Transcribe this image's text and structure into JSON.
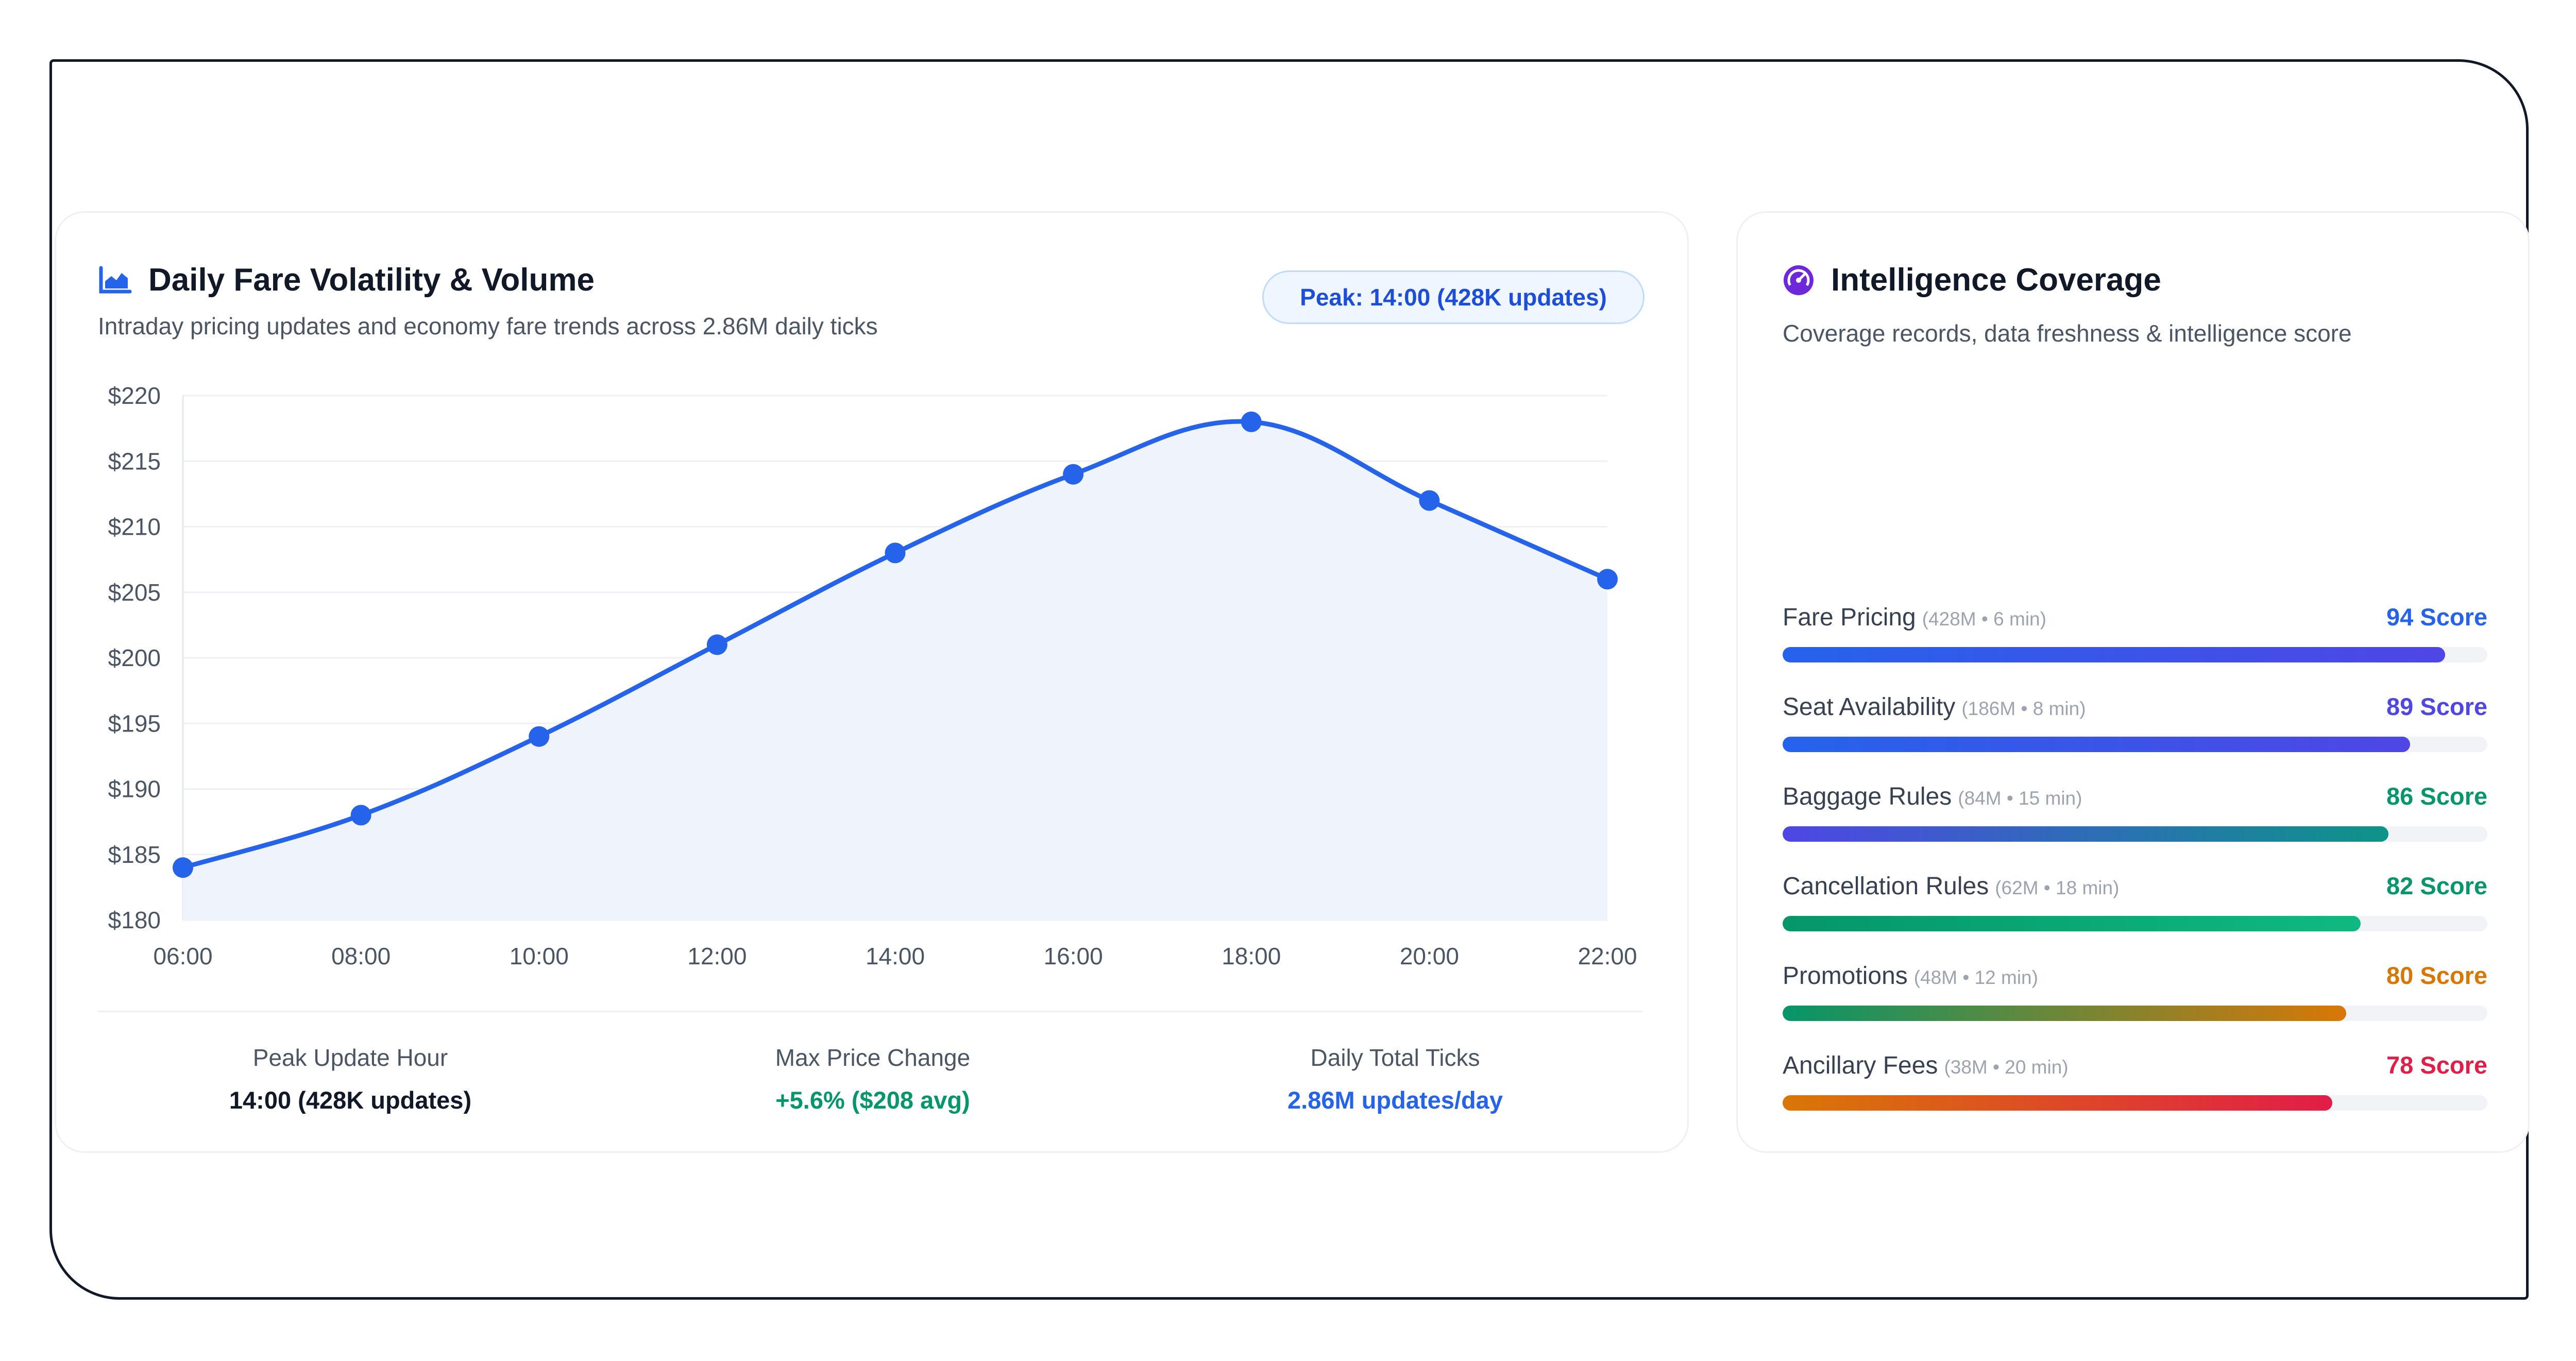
{
  "fare_card": {
    "icon": "area-chart-icon",
    "title": "Daily Fare Volatility & Volume",
    "subtitle": "Intraday pricing updates and economy fare trends across 2.86M daily ticks",
    "peak_badge": "Peak: 14:00 (428K updates)"
  },
  "chart_data": {
    "type": "area",
    "title": "Daily Fare Volatility & Volume",
    "x": [
      "06:00",
      "08:00",
      "10:00",
      "12:00",
      "14:00",
      "16:00",
      "18:00",
      "20:00",
      "22:00"
    ],
    "series": [
      {
        "values": [
          184,
          188,
          194,
          201,
          208,
          214,
          218,
          212,
          206
        ]
      }
    ],
    "y_ticks": [
      "$180",
      "$185",
      "$190",
      "$195",
      "$200",
      "$205",
      "$210",
      "$215",
      "$220"
    ],
    "ylim": [
      180,
      220
    ],
    "xlabel": "",
    "ylabel": "",
    "grid": true,
    "line_color": "#2563eb",
    "fill_color": "#eef3fc"
  },
  "stats": [
    {
      "label": "Peak Update Hour",
      "value": "14:00 (428K updates)",
      "color": "#111827"
    },
    {
      "label": "Max Price Change",
      "value": "+5.6% ($208 avg)",
      "color": "#059669"
    },
    {
      "label": "Daily Total Ticks",
      "value": "2.86M updates/day",
      "color": "#2563eb"
    }
  ],
  "coverage_card": {
    "icon": "gauge-icon",
    "title": "Intelligence Coverage",
    "subtitle": "Coverage records, data freshness & intelligence score",
    "items": [
      {
        "label": "Fare Pricing",
        "meta": "(428M • 6 min)",
        "score": "94 Score",
        "fill": 0.94,
        "score_color": "#2563eb",
        "gradient": [
          "#2563eb",
          "#4f46e5"
        ]
      },
      {
        "label": "Seat Availability",
        "meta": "(186M • 8 min)",
        "score": "89 Score",
        "fill": 0.89,
        "score_color": "#4f46e5",
        "gradient": [
          "#2563eb",
          "#4f46e5"
        ]
      },
      {
        "label": "Baggage Rules",
        "meta": "(84M • 15 min)",
        "score": "86 Score",
        "fill": 0.86,
        "score_color": "#059669",
        "gradient": [
          "#4f46e5",
          "#0d9488"
        ]
      },
      {
        "label": "Cancellation Rules",
        "meta": "(62M • 18 min)",
        "score": "82 Score",
        "fill": 0.82,
        "score_color": "#059669",
        "gradient": [
          "#059669",
          "#10b981"
        ]
      },
      {
        "label": "Promotions",
        "meta": "(48M • 12 min)",
        "score": "80 Score",
        "fill": 0.8,
        "score_color": "#d97706",
        "gradient": [
          "#059669",
          "#d97706"
        ]
      },
      {
        "label": "Ancillary Fees",
        "meta": "(38M • 20 min)",
        "score": "78 Score",
        "fill": 0.78,
        "score_color": "#e11d48",
        "gradient": [
          "#d97706",
          "#e11d48"
        ]
      }
    ]
  }
}
